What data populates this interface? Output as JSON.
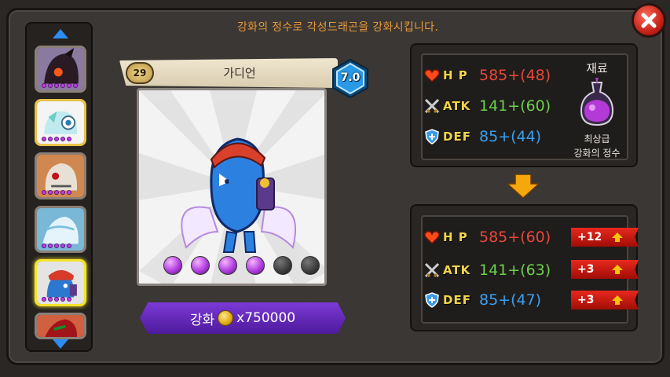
{
  "header": {
    "instruction": "강화의 정수로 각성드래곤을 강화시킵니다."
  },
  "roster": {
    "slots": [
      {
        "name": "slot-dark-dragon",
        "dots": 6,
        "color": "#3a2030"
      },
      {
        "name": "slot-ice-eye",
        "dots": 5,
        "color": "#dff0f4"
      },
      {
        "name": "slot-skull",
        "dots": 5,
        "color": "#d4a070"
      },
      {
        "name": "slot-frost",
        "dots": 5,
        "color": "#8cc8e0"
      },
      {
        "name": "slot-guardian",
        "dots": 5,
        "color": "#3070c0"
      },
      {
        "name": "slot-red",
        "dots": 0,
        "color": "#b82820"
      }
    ]
  },
  "card": {
    "level": "29",
    "name": "가디언",
    "grade": "7.0",
    "orbs_filled": 4,
    "orbs_total": 6
  },
  "enhance": {
    "label": "강화",
    "cost": "x750000"
  },
  "current": {
    "hp_label": "H P",
    "hp_value": "585+(48)",
    "atk_label": "ATK",
    "atk_value": "141+(60)",
    "def_label": "DEF",
    "def_value": "85+(44)"
  },
  "material": {
    "title": "재료",
    "name_line1": "최상급",
    "name_line2": "강화의 정수"
  },
  "result": {
    "hp_label": "H P",
    "hp_value": "585+(60)",
    "hp_bonus": "+12",
    "atk_label": "ATK",
    "atk_value": "141+(63)",
    "atk_bonus": "+3",
    "def_label": "DEF",
    "def_value": "85+(47)",
    "def_bonus": "+3"
  },
  "colors": {
    "hp": "#e8473a",
    "atk": "#6cd04a",
    "def": "#3aa0f0",
    "accent": "#e79a3a"
  }
}
